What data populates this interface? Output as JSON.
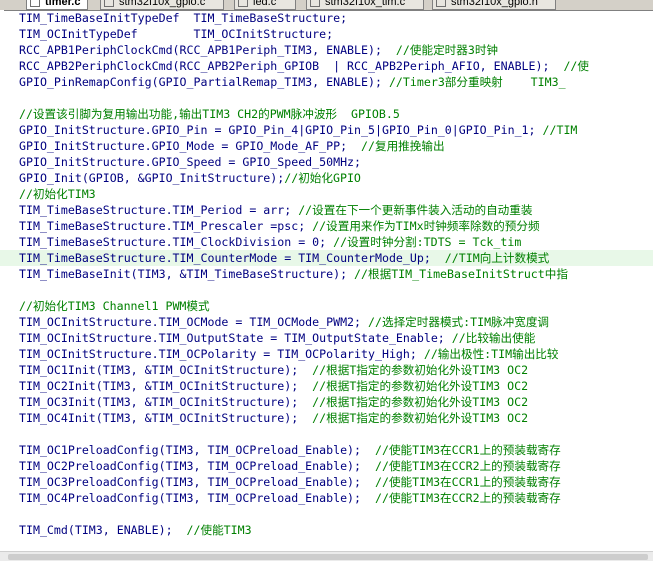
{
  "tabs": [
    {
      "label": "timer.c",
      "active": true
    },
    {
      "label": "stm32f10x_gpio.c",
      "active": false
    },
    {
      "label": "led.c",
      "active": false
    },
    {
      "label": "stm32f10x_tim.c",
      "active": false
    },
    {
      "label": "stm32f10x_gpio.h",
      "active": false
    }
  ],
  "colors": {
    "code": "#000080",
    "comment": "#008000",
    "current_line": "#e8f8e8",
    "tab_bar": "#d4d0c8"
  },
  "code_lines": [
    {
      "code": "TIM_TimeBaseInitTypeDef  TIM_TimeBaseStructure;",
      "comment": ""
    },
    {
      "code": "TIM_OCInitTypeDef        TIM_OCInitStructure;",
      "comment": ""
    },
    {
      "code": "RCC_APB1PeriphClockCmd(RCC_APB1Periph_TIM3, ENABLE);  ",
      "comment": "//使能定时器3时钟"
    },
    {
      "code": "RCC_APB2PeriphClockCmd(RCC_APB2Periph_GPIOB  | RCC_APB2Periph_AFIO, ENABLE);  ",
      "comment": "//使"
    },
    {
      "code": "GPIO_PinRemapConfig(GPIO_PartialRemap_TIM3, ENABLE); ",
      "comment": "//Timer3部分重映射    TIM3_"
    },
    {
      "code": "",
      "comment": ""
    },
    {
      "code": "",
      "comment": "//设置该引脚为复用输出功能,输出TIM3 CH2的PWM脉冲波形  GPIOB.5"
    },
    {
      "code": "GPIO_InitStructure.GPIO_Pin = GPIO_Pin_4|GPIO_Pin_5|GPIO_Pin_0|GPIO_Pin_1; ",
      "comment": "//TIM"
    },
    {
      "code": "GPIO_InitStructure.GPIO_Mode = GPIO_Mode_AF_PP;  ",
      "comment": "//复用推挽输出"
    },
    {
      "code": "GPIO_InitStructure.GPIO_Speed = GPIO_Speed_50MHz;",
      "comment": ""
    },
    {
      "code": "GPIO_Init(GPIOB, &GPIO_InitStructure);",
      "comment": "//初始化GPIO"
    },
    {
      "code": "",
      "comment": "//初始化TIM3"
    },
    {
      "code": "TIM_TimeBaseStructure.TIM_Period = arr; ",
      "comment": "//设置在下一个更新事件装入活动的自动重装"
    },
    {
      "code": "TIM_TimeBaseStructure.TIM_Prescaler =psc; ",
      "comment": "//设置用来作为TIMx时钟频率除数的预分频"
    },
    {
      "code": "TIM_TimeBaseStructure.TIM_ClockDivision = 0; ",
      "comment": "//设置时钟分割:TDTS = Tck_tim"
    },
    {
      "code": "TIM_TimeBaseStructure.TIM_CounterMode = TIM_CounterMode_Up;  ",
      "comment": "//TIM向上计数模式"
    },
    {
      "code": "TIM_TimeBaseInit(TIM3, &TIM_TimeBaseStructure); ",
      "comment": "//根据TIM_TimeBaseInitStruct中指"
    },
    {
      "code": "",
      "comment": ""
    },
    {
      "code": "",
      "comment": "//初始化TIM3 Channel1 PWM模式"
    },
    {
      "code": "TIM_OCInitStructure.TIM_OCMode = TIM_OCMode_PWM2; ",
      "comment": "//选择定时器模式:TIM脉冲宽度调"
    },
    {
      "code": "TIM_OCInitStructure.TIM_OutputState = TIM_OutputState_Enable; ",
      "comment": "//比较输出使能"
    },
    {
      "code": "TIM_OCInitStructure.TIM_OCPolarity = TIM_OCPolarity_High; ",
      "comment": "//输出极性:TIM输出比较"
    },
    {
      "code": "TIM_OC1Init(TIM3, &TIM_OCInitStructure);  ",
      "comment": "//根据T指定的参数初始化外设TIM3 OC2"
    },
    {
      "code": "TIM_OC2Init(TIM3, &TIM_OCInitStructure);  ",
      "comment": "//根据T指定的参数初始化外设TIM3 OC2"
    },
    {
      "code": "TIM_OC3Init(TIM3, &TIM_OCInitStructure);  ",
      "comment": "//根据T指定的参数初始化外设TIM3 OC2"
    },
    {
      "code": "TIM_OC4Init(TIM3, &TIM_OCInitStructure);  ",
      "comment": "//根据T指定的参数初始化外设TIM3 OC2"
    },
    {
      "code": "",
      "comment": ""
    },
    {
      "code": "TIM_OC1PreloadConfig(TIM3, TIM_OCPreload_Enable);  ",
      "comment": "//使能TIM3在CCR1上的预装载寄存"
    },
    {
      "code": "TIM_OC2PreloadConfig(TIM3, TIM_OCPreload_Enable);  ",
      "comment": "//使能TIM3在CCR2上的预装载寄存"
    },
    {
      "code": "TIM_OC3PreloadConfig(TIM3, TIM_OCPreload_Enable);  ",
      "comment": "//使能TIM3在CCR1上的预装载寄存"
    },
    {
      "code": "TIM_OC4PreloadConfig(TIM3, TIM_OCPreload_Enable);  ",
      "comment": "//使能TIM3在CCR2上的预装载寄存"
    },
    {
      "code": "",
      "comment": ""
    },
    {
      "code": "TIM_Cmd(TIM3, ENABLE);  ",
      "comment": "//使能TIM3"
    },
    {
      "code": "",
      "comment": ""
    }
  ]
}
